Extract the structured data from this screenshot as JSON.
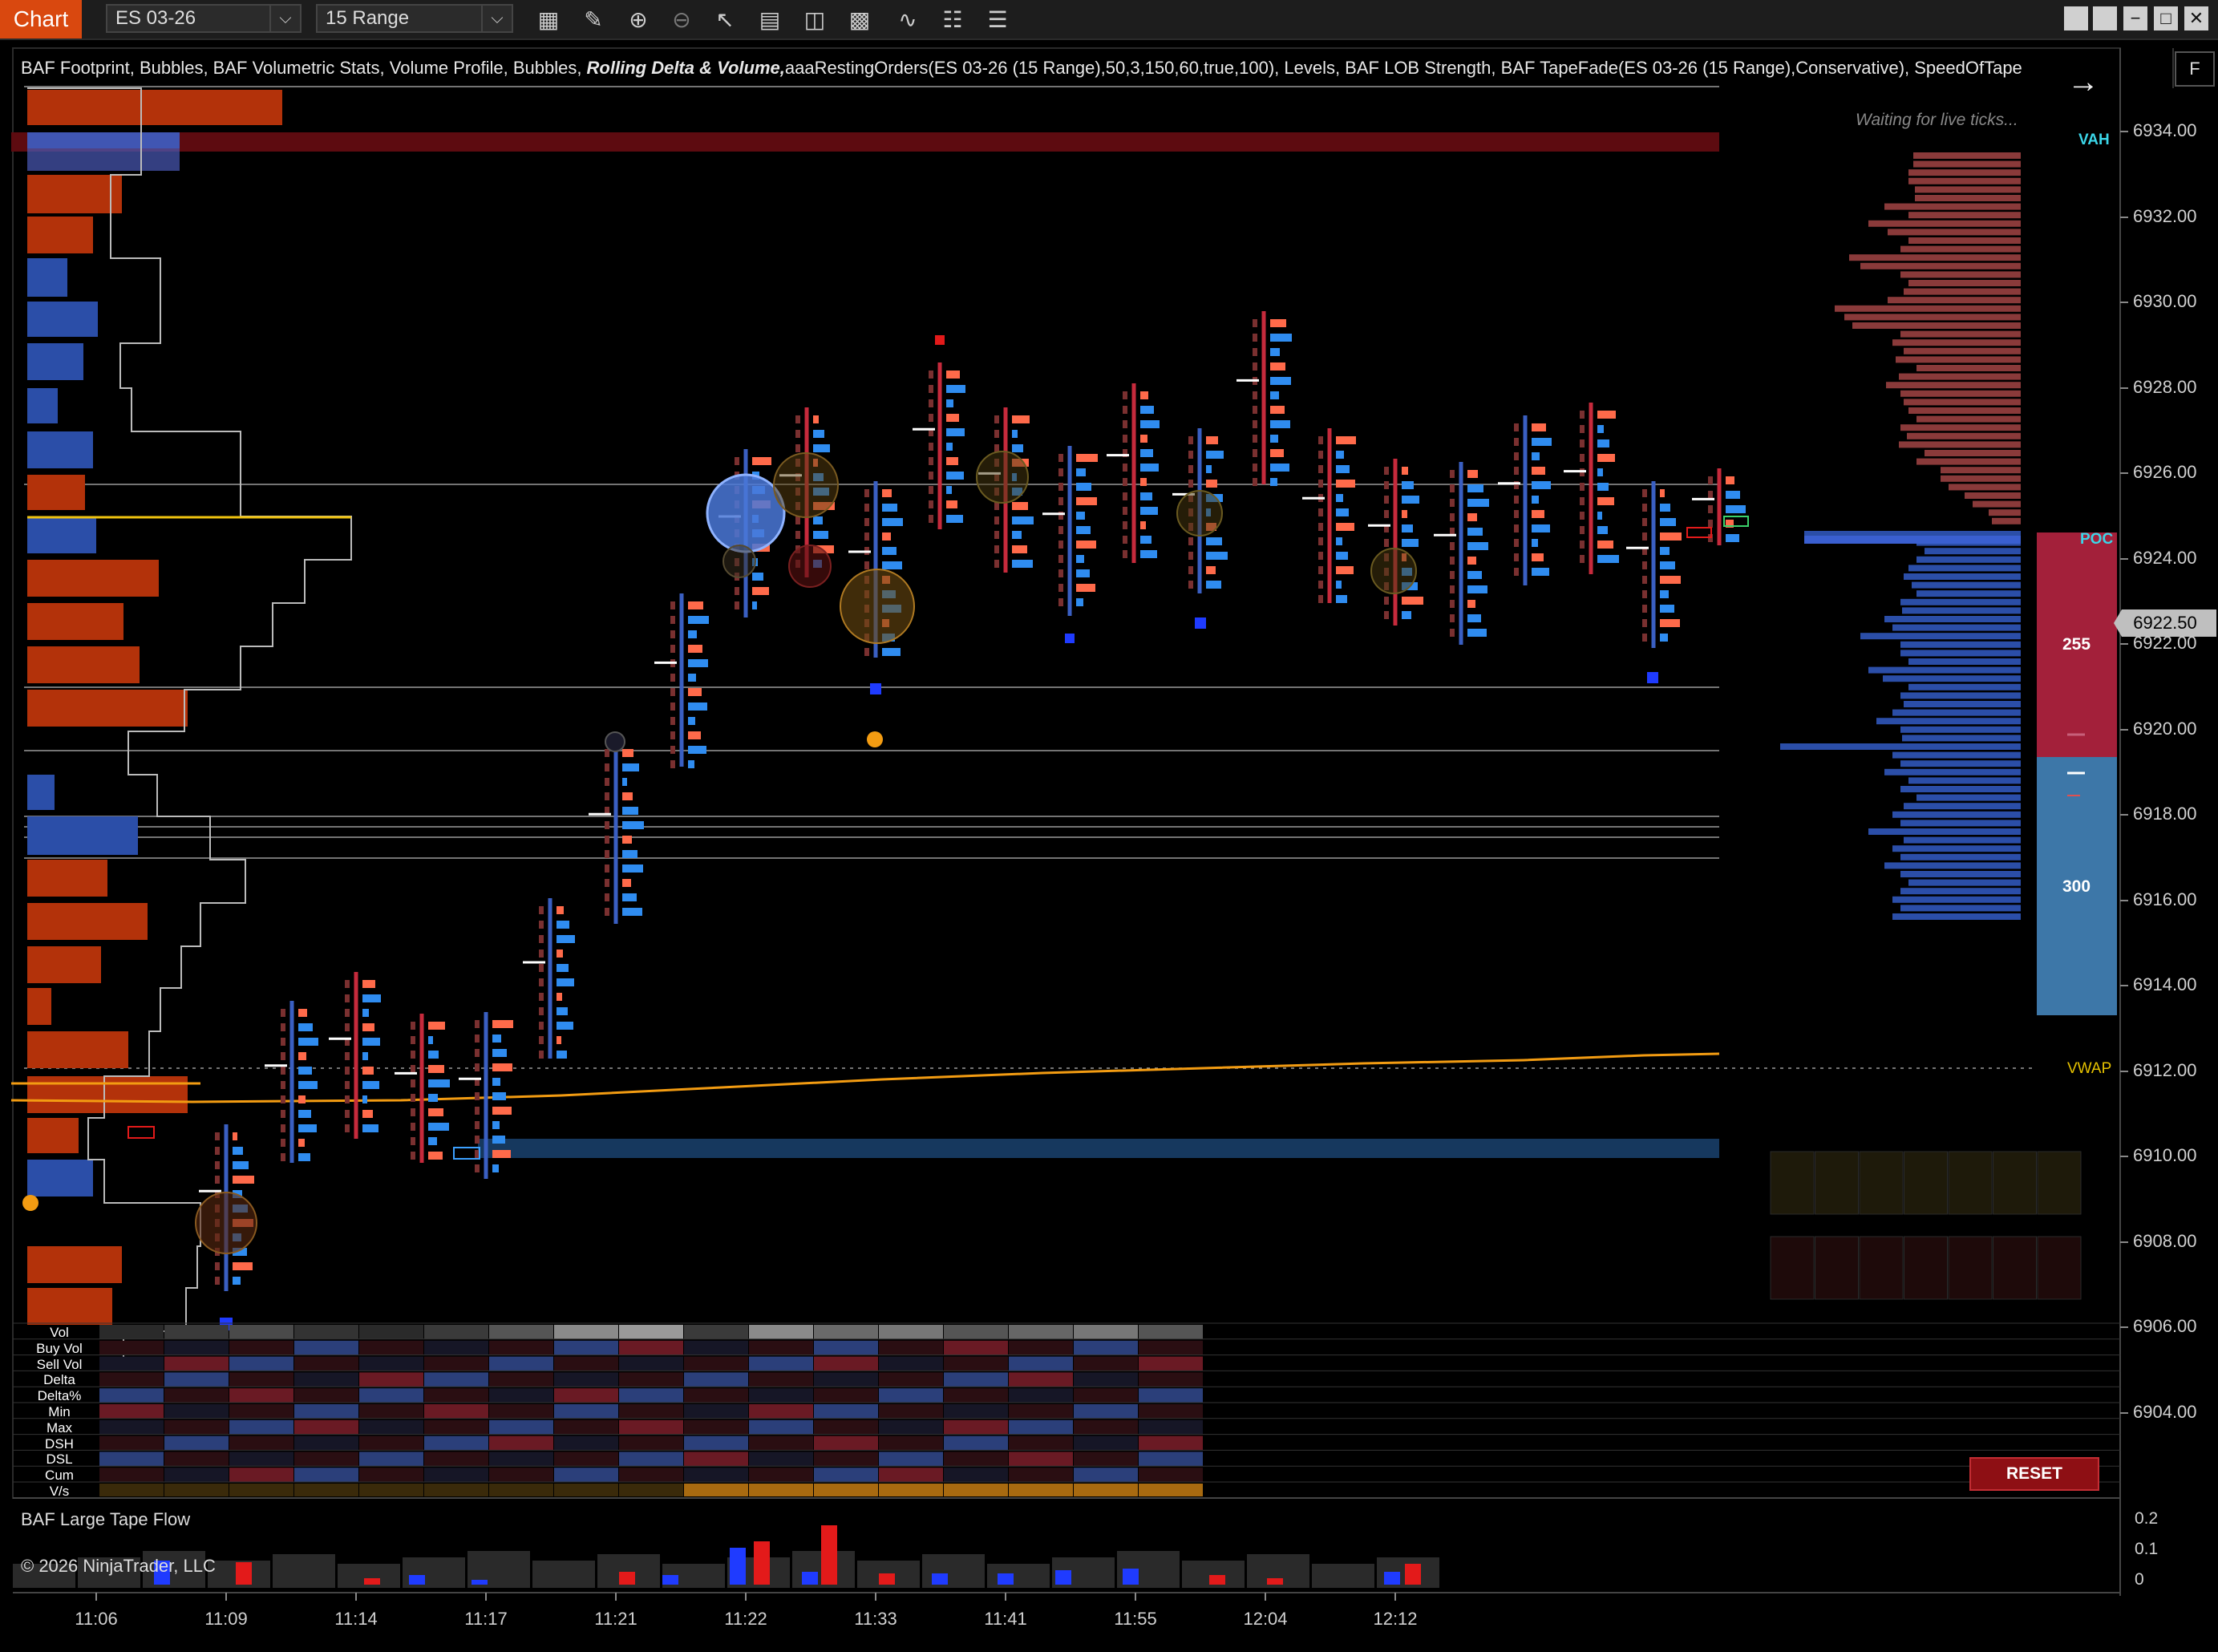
{
  "toolbar": {
    "chart_tab": "Chart",
    "instrument": "ES 03-26",
    "period": "15 Range",
    "window_controls": [
      "restore-icon",
      "restore-icon",
      "minimize-icon",
      "maximize-icon",
      "close-icon"
    ]
  },
  "indicator_legend": {
    "prefix": "BAF Footprint, Bubbles, BAF Volumetric Stats, Volume Profile, Bubbles, ",
    "bold_item": "Rolling Delta & Volume,",
    "suffix": "aaaRestingOrders(ES 03-26 (15 Range),50,3,150,60,true,100), Levels, BAF LOB Strength, BAF TapeFade(ES 03-26 (15 Range),Conservative), SpeedOfTape"
  },
  "status": {
    "waiting": "Waiting for live ticks...",
    "f_button": "F"
  },
  "price_axis": {
    "labels": [
      "6934.00",
      "6932.00",
      "6930.00",
      "6928.00",
      "6926.00",
      "6924.00",
      "6922.00",
      "6920.00",
      "6918.00",
      "6916.00",
      "6914.00",
      "6912.00",
      "6910.00",
      "6908.00",
      "6906.00",
      "6904.00"
    ],
    "current_price": "6922.50"
  },
  "profile_tags": {
    "vah": "VAH",
    "poc": "POC",
    "vwap": "VWAP"
  },
  "lob_strength": {
    "ask_value": "255",
    "bid_value": "300"
  },
  "stats_rows": [
    "Vol",
    "Buy Vol",
    "Sell Vol",
    "Delta",
    "Delta%",
    "Min",
    "Max",
    "DSH",
    "DSL",
    "Cum",
    "V/s"
  ],
  "reset_label": "RESET",
  "lower_panel": {
    "title": "BAF Large Tape Flow",
    "copyright": "© 2026 NinjaTrader, LLC",
    "axis": [
      "0.2",
      "0.1",
      "0"
    ]
  },
  "time_axis": [
    "11:06",
    "11:09",
    "11:14",
    "11:17",
    "11:21",
    "11:22",
    "11:33",
    "11:41",
    "11:55",
    "12:04",
    "12:12"
  ],
  "colors": {
    "accent_orange": "#d9480f",
    "bid_blue": "#2f6bd6",
    "ask_red": "#d42a3c",
    "vwap": "#f39c12",
    "profile_sell": "#8a3a3a",
    "profile_buy": "#2b4ea8"
  }
}
